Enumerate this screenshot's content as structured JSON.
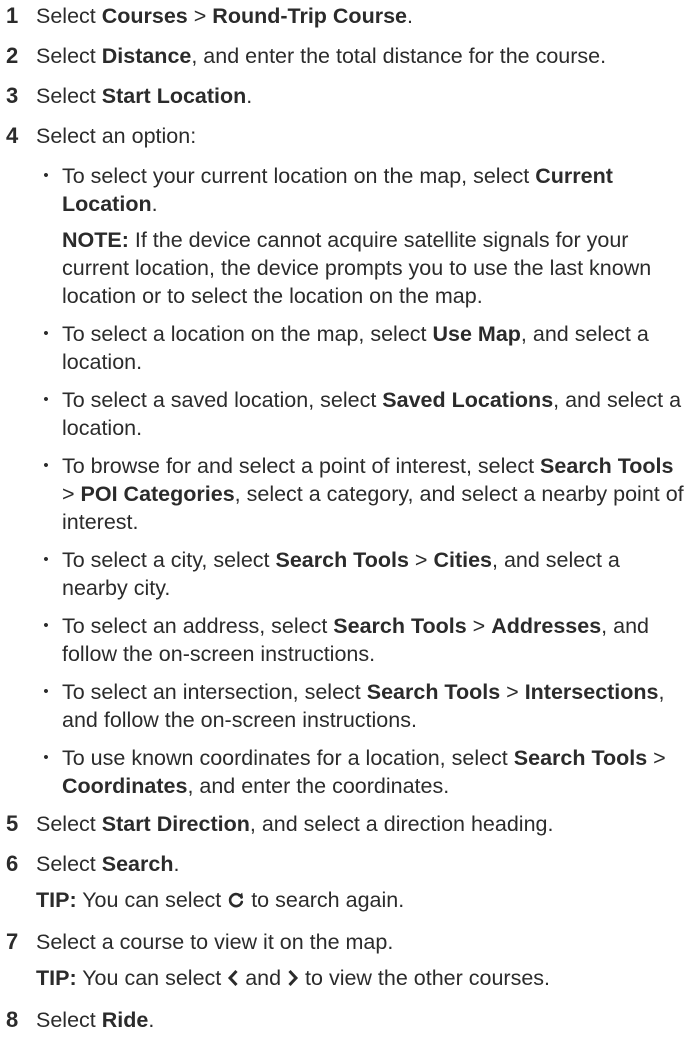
{
  "steps": [
    {
      "number": "1",
      "parts": [
        "Select ",
        {
          "b": "Courses"
        },
        " > ",
        {
          "b": "Round-Trip Course"
        },
        "."
      ]
    },
    {
      "number": "2",
      "parts": [
        "Select ",
        {
          "b": "Distance"
        },
        ", and enter the total distance for the course."
      ]
    },
    {
      "number": "3",
      "parts": [
        "Select ",
        {
          "b": "Start Location"
        },
        "."
      ]
    },
    {
      "number": "4",
      "parts": [
        "Select an option:"
      ],
      "bullets": [
        {
          "parts": [
            "To select your current location on the map, select ",
            {
              "b": "Current Location"
            },
            "."
          ],
          "note": {
            "label": "NOTE:",
            "text": " If the device cannot acquire satellite signals for your current location, the device prompts you to use the last known location or to select the location on the map."
          }
        },
        {
          "parts": [
            "To select a location on the map, select ",
            {
              "b": "Use Map"
            },
            ", and select a location."
          ]
        },
        {
          "parts": [
            "To select a saved location, select ",
            {
              "b": "Saved Locations"
            },
            ", and select a location."
          ]
        },
        {
          "parts": [
            "To browse for and select a point of interest, select ",
            {
              "b": "Search Tools"
            },
            " > ",
            {
              "b": "POI Categories"
            },
            ", select a category, and select a nearby point of interest."
          ]
        },
        {
          "parts": [
            "To select a city, select ",
            {
              "b": "Search Tools"
            },
            " > ",
            {
              "b": "Cities"
            },
            ", and select a nearby city."
          ]
        },
        {
          "parts": [
            "To select an address, select ",
            {
              "b": "Search Tools"
            },
            " > ",
            {
              "b": "Addresses"
            },
            ", and follow the on-screen instructions."
          ]
        },
        {
          "parts": [
            "To select an intersection, select ",
            {
              "b": "Search Tools"
            },
            " > ",
            {
              "b": "Intersections"
            },
            ", and follow the on-screen instructions."
          ]
        },
        {
          "parts": [
            "To use known coordinates for a location, select ",
            {
              "b": "Search Tools"
            },
            " > ",
            {
              "b": "Coordinates"
            },
            ", and enter the coordinates."
          ]
        }
      ]
    },
    {
      "number": "5",
      "parts": [
        "Select ",
        {
          "b": "Start Direction"
        },
        ", and select a direction heading."
      ]
    },
    {
      "number": "6",
      "parts": [
        "Select ",
        {
          "b": "Search"
        },
        "."
      ],
      "tip": {
        "label": "TIP:",
        "parts": [
          " You can select ",
          {
            "icon": "refresh-icon"
          },
          " to search again."
        ]
      }
    },
    {
      "number": "7",
      "parts": [
        "Select a course to view it on the map."
      ],
      "tip": {
        "label": "TIP:",
        "parts": [
          " You can select ",
          {
            "icon": "chevron-left-icon"
          },
          " and ",
          {
            "icon": "chevron-right-icon"
          },
          " to view the other courses."
        ]
      }
    },
    {
      "number": "8",
      "parts": [
        "Select ",
        {
          "b": "Ride"
        },
        "."
      ]
    }
  ],
  "colors": {
    "text": "#2b2b2b",
    "background": "#ffffff"
  }
}
